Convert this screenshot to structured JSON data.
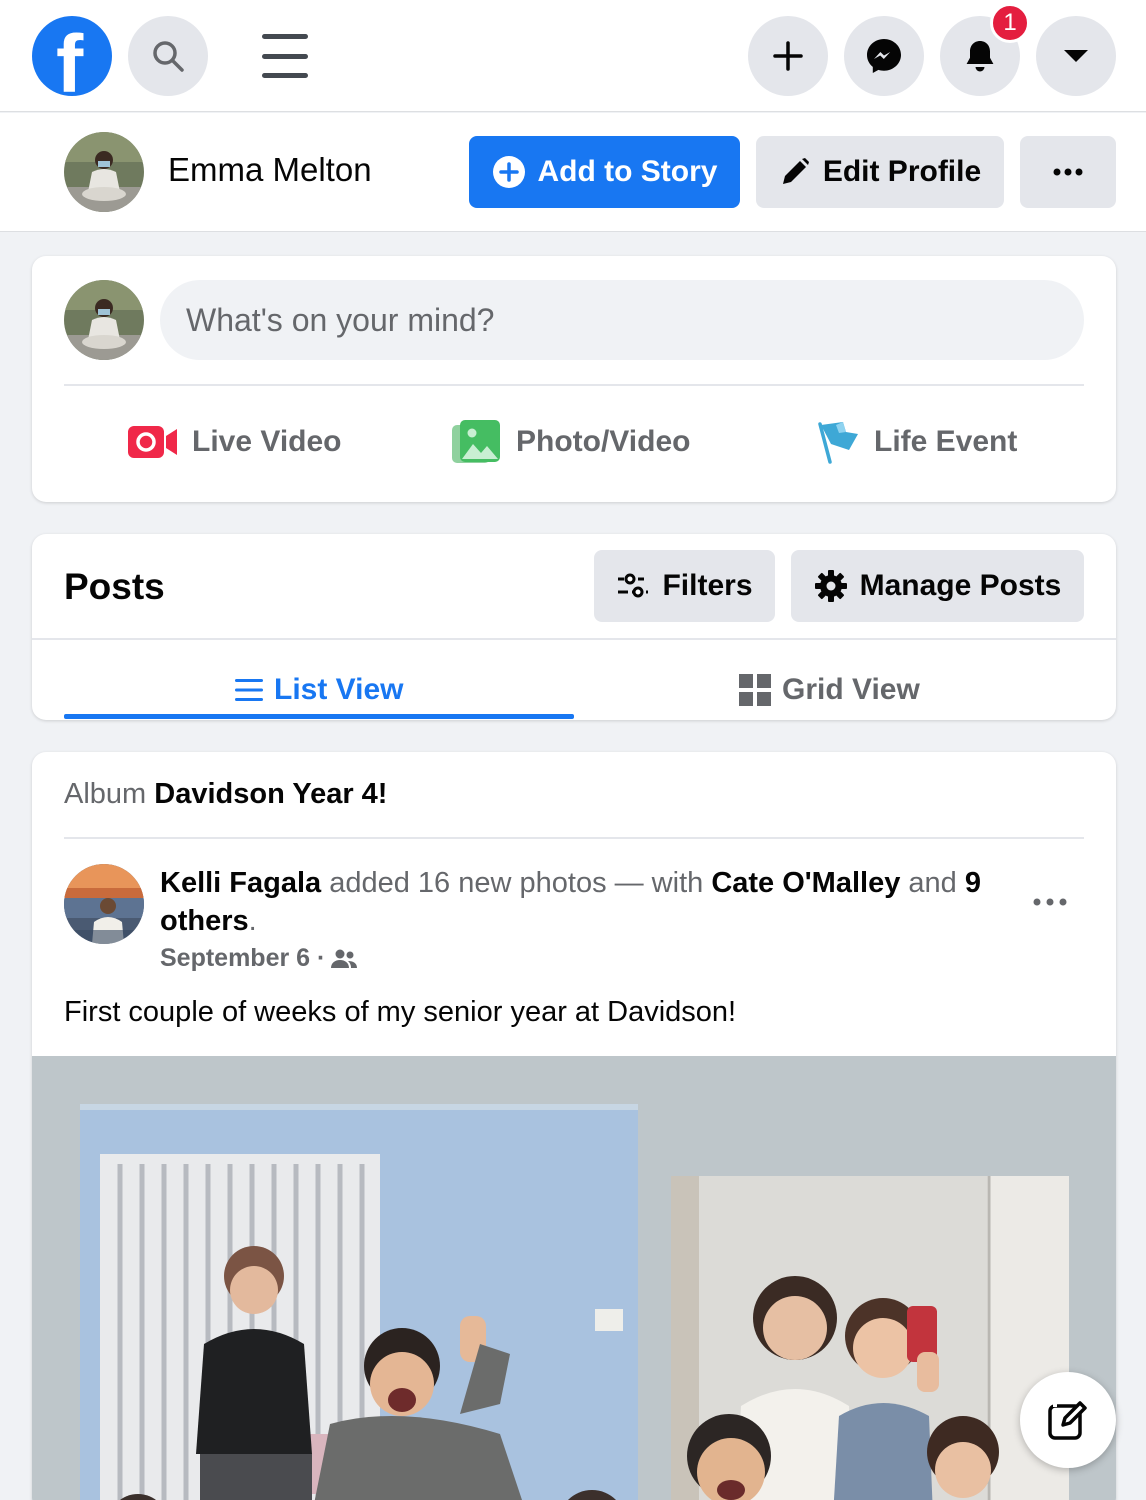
{
  "topbar": {
    "notification_count": "1",
    "icons": [
      "facebook-logo",
      "search-icon",
      "menu-icon",
      "plus-icon",
      "messenger-icon",
      "bell-icon",
      "caret-down-icon"
    ]
  },
  "profile": {
    "name": "Emma Melton",
    "add_story_label": "Add to Story",
    "edit_profile_label": "Edit Profile"
  },
  "composer": {
    "placeholder": "What's on your mind?",
    "actions": [
      {
        "label": "Live Video",
        "color": "#f02849"
      },
      {
        "label": "Photo/Video",
        "color": "#45bd62"
      },
      {
        "label": "Life Event",
        "color": "#3ea8d6"
      }
    ]
  },
  "posts": {
    "title": "Posts",
    "filters_label": "Filters",
    "manage_label": "Manage Posts",
    "tabs": [
      {
        "label": "List View",
        "active": true
      },
      {
        "label": "Grid View",
        "active": false
      }
    ]
  },
  "post": {
    "album_prefix": "Album",
    "album_name": "Davidson Year 4!",
    "author": "Kelli Fagala",
    "action_text": " added 16 new photos — with ",
    "tagged": "Cate O'Malley",
    "and_text": " and ",
    "others": "9 others",
    "period": ".",
    "date": "September 6 ·",
    "text": "First couple of weeks of my senior year at Davidson!"
  },
  "colors": {
    "accent": "#1877f2",
    "notification": "#e41e3f",
    "background": "#f0f2f5"
  }
}
